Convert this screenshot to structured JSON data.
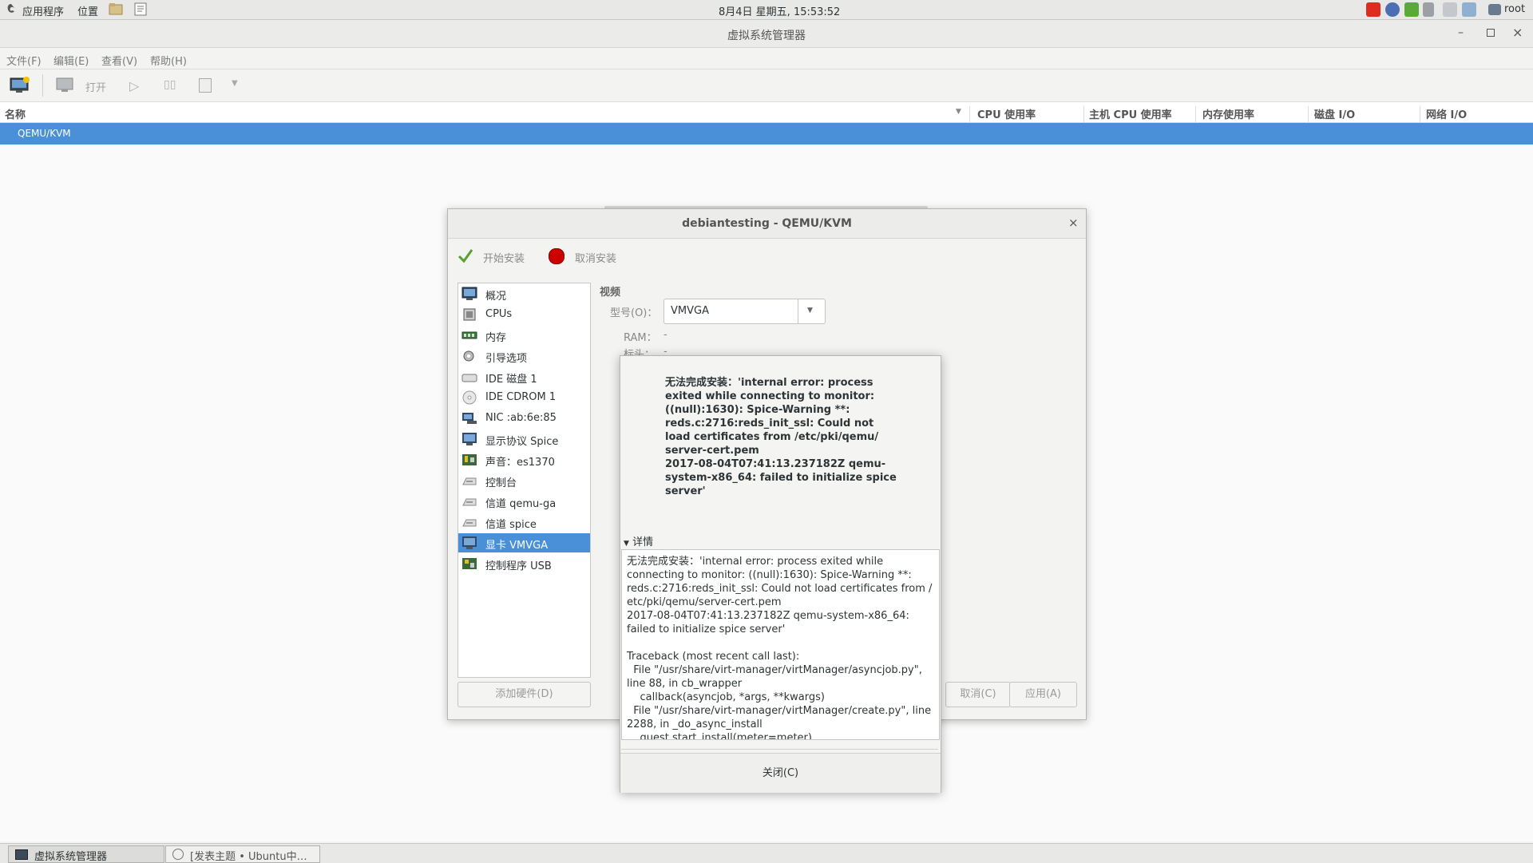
{
  "topbar": {
    "apps_label": "应用程序",
    "places_label": "位置",
    "clock": "8月4日 星期五, 15:53:52",
    "user": "root"
  },
  "window": {
    "title": "虚拟系统管理器",
    "menu": [
      "文件(F)",
      "编辑(E)",
      "查看(V)",
      "帮助(H)"
    ],
    "toolbar": {
      "open_label": "打开"
    },
    "columns": [
      "名称",
      "CPU 使用率",
      "主机 CPU 使用率",
      "内存使用率",
      "磁盘 I/O",
      "网络 I/O"
    ],
    "selected_connection": "QEMU/KVM"
  },
  "dialog": {
    "title": "debiantesting - QEMU/KVM",
    "begin_install": "开始安装",
    "cancel_install": "取消安装",
    "hardware_items": [
      {
        "label": "概况",
        "icon": "monitor-icon"
      },
      {
        "label": "CPUs",
        "icon": "cpu-icon"
      },
      {
        "label": "内存",
        "icon": "memory-icon"
      },
      {
        "label": "引导选项",
        "icon": "gear-icon"
      },
      {
        "label": "IDE 磁盘 1",
        "icon": "disk-icon"
      },
      {
        "label": "IDE CDROM 1",
        "icon": "cdrom-icon"
      },
      {
        "label": "NIC :ab:6e:85",
        "icon": "network-icon"
      },
      {
        "label": "显示协议 Spice",
        "icon": "display-icon"
      },
      {
        "label": "声音：es1370",
        "icon": "sound-icon"
      },
      {
        "label": "控制台",
        "icon": "serial-icon"
      },
      {
        "label": "信道 qemu-ga",
        "icon": "serial-icon"
      },
      {
        "label": "信道 spice",
        "icon": "serial-icon"
      },
      {
        "label": "显卡 VMVGA",
        "icon": "video-card-icon",
        "selected": true
      },
      {
        "label": "控制程序 USB",
        "icon": "usb-controller-icon"
      }
    ],
    "add_hardware": "添加硬件(D)",
    "section_title": "视频",
    "model_label": "型号(O)：",
    "model_value": "VMVGA",
    "ram_label": "RAM：",
    "ram_value": "-",
    "heads_label": "标头：",
    "heads_value": "-",
    "cancel_button": "取消(C)",
    "apply_button": "应用(A)"
  },
  "error": {
    "message": "无法完成安装：'internal error: process\nexited while connecting to monitor:\n((null):1630): Spice-Warning **:\nreds.c:2716:reds_init_ssl: Could not\nload certificates from /etc/pki/qemu/\nserver-cert.pem\n2017-08-04T07:41:13.237182Z qemu-\nsystem-x86_64: failed to initialize spice\nserver'",
    "details_label": "详情",
    "details_text": "无法完成安装：'internal error: process exited while\nconnecting to monitor: ((null):1630): Spice-Warning **:\nreds.c:2716:reds_init_ssl: Could not load certificates from /\netc/pki/qemu/server-cert.pem\n2017-08-04T07:41:13.237182Z qemu-system-x86_64:\nfailed to initialize spice server'\n\nTraceback (most recent call last):\n  File \"/usr/share/virt-manager/virtManager/asyncjob.py\",\nline 88, in cb_wrapper\n    callback(asyncjob, *args, **kwargs)\n  File \"/usr/share/virt-manager/virtManager/create.py\", line\n2288, in _do_async_install\n    guest.start_install(meter=meter)",
    "close_button": "关闭(C)"
  },
  "taskbar": {
    "items": [
      "虚拟系统管理器",
      "[发表主题 • Ubuntu中…"
    ]
  },
  "colors": {
    "selection": "#4a90d9"
  }
}
